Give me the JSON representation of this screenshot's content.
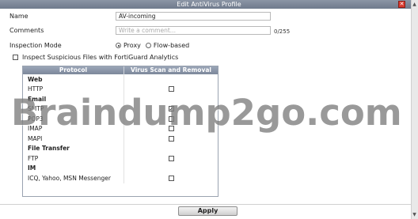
{
  "dialog": {
    "title": "Edit AntiVirus Profile",
    "close_glyph": "✕"
  },
  "form": {
    "name_label": "Name",
    "name_value": "AV-incoming",
    "comments_label": "Comments",
    "comments_placeholder": "Write a comment...",
    "comments_counter": "0/255",
    "inspection_label": "Inspection Mode",
    "inspection_options": [
      "Proxy",
      "Flow-based"
    ],
    "inspection_selected": "Proxy",
    "suspicious_label": "Inspect Suspicious Files with FortiGuard Analytics",
    "suspicious_checked": false
  },
  "table": {
    "headers": [
      "Protocol",
      "Virus Scan and Removal"
    ],
    "rows": [
      {
        "name": "Web",
        "type": "group"
      },
      {
        "name": "HTTP",
        "type": "item",
        "checked": false
      },
      {
        "name": "Email",
        "type": "group"
      },
      {
        "name": "SMTP",
        "type": "item",
        "checked": true
      },
      {
        "name": "POP3",
        "type": "item",
        "checked": false
      },
      {
        "name": "IMAP",
        "type": "item",
        "checked": false
      },
      {
        "name": "MAPI",
        "type": "item",
        "checked": false
      },
      {
        "name": "File Transfer",
        "type": "group"
      },
      {
        "name": "FTP",
        "type": "item",
        "checked": false
      },
      {
        "name": "IM",
        "type": "group"
      },
      {
        "name": "ICQ, Yahoo, MSN Messenger",
        "type": "item",
        "checked": false
      }
    ]
  },
  "watermark": "Braindump2go.com",
  "footer": {
    "apply_label": "Apply"
  },
  "colors": {
    "titlebar": "#7d889b",
    "close": "#d83a2f",
    "table_header": "#8e99ab"
  },
  "icons": {
    "close": "close-icon",
    "scroll_up": "scroll-up-icon",
    "scroll_down": "scroll-down-icon"
  }
}
